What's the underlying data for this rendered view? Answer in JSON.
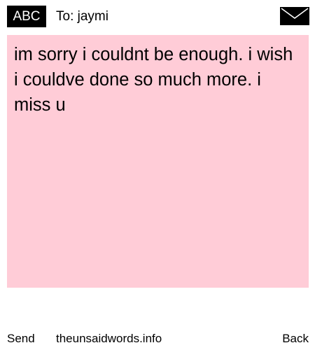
{
  "header": {
    "badge_label": "ABC",
    "to_label": "To: jaymi",
    "envelope_icon": "envelope-icon"
  },
  "message": {
    "text": "im sorry i couldnt be enough. i wish i couldve done so much more. i miss u",
    "background": "#ffccd7"
  },
  "footer": {
    "send_label": "Send",
    "site_label": "theunsaidwords.info",
    "back_label": "Back"
  }
}
